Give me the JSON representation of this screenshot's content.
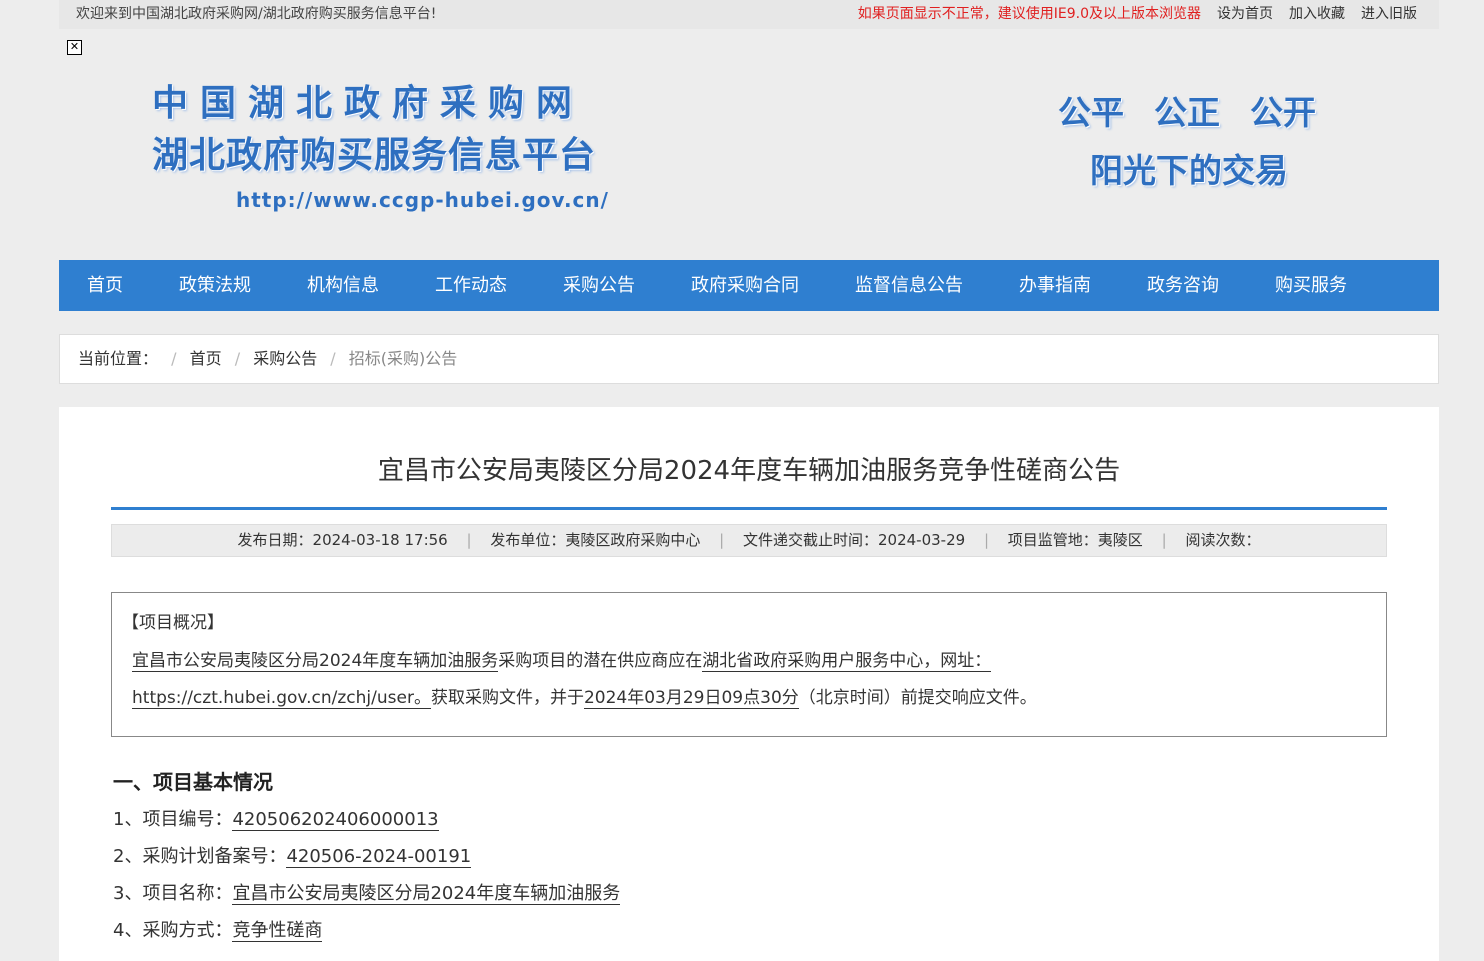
{
  "topbar": {
    "welcome": "欢迎来到中国湖北政府采购网/湖北政府购买服务信息平台!",
    "warning": "如果页面显示不正常，建议使用IE9.0及以上版本浏览器",
    "set_home": "设为首页",
    "add_favorite": "加入收藏",
    "old_version": "进入旧版"
  },
  "header": {
    "close_glyph": "✕",
    "logo_line1": "中国湖北政府采购网",
    "logo_line2": "湖北政府购买服务信息平台",
    "logo_url": "http://www.ccgp-hubei.gov.cn/",
    "slogan_fair": "公平",
    "slogan_just": "公正",
    "slogan_open": "公开",
    "slogan_line2": "阳光下的交易"
  },
  "nav": {
    "items": [
      "首页",
      "政策法规",
      "机构信息",
      "工作动态",
      "采购公告",
      "政府采购合同",
      "监督信息公告",
      "办事指南",
      "政务咨询",
      "购买服务"
    ]
  },
  "breadcrumb": {
    "label": "当前位置：",
    "sep": "/",
    "home": "首页",
    "section": "采购公告",
    "current": "招标(采购)公告"
  },
  "article": {
    "title": "宜昌市公安局夷陵区分局2024年度车辆加油服务竞争性磋商公告",
    "meta": {
      "publish_date": "发布日期：2024-03-18 17:56",
      "publisher": "发布单位：夷陵区政府采购中心",
      "deadline": "文件递交截止时间：2024-03-29",
      "supervision": "项目监管地：夷陵区",
      "reads": "阅读次数：",
      "bar": "|"
    },
    "overview": {
      "heading": "【项目概况】",
      "p1_a": "宜昌市公安局夷陵区分局2024年度车辆加油服务",
      "p1_b": "采购项目的潜在供应商应在",
      "p1_c": "湖北省政府采购用户服务中心，网址：",
      "p2_a": "https://czt.hubei.gov.cn/zchj/user。",
      "p2_b": "获取采购文件，并于",
      "p2_c": "2024年03月29日09点30分",
      "p2_d": "（北京时间）前提交响应文件。"
    },
    "section1_title": "一、项目基本情况",
    "items": [
      {
        "label": "1、项目编号：",
        "value": "420506202406000013"
      },
      {
        "label": "2、采购计划备案号：",
        "value": "420506-2024-00191"
      },
      {
        "label": "3、项目名称：",
        "value": "宜昌市公安局夷陵区分局2024年度车辆加油服务"
      },
      {
        "label": "4、采购方式：",
        "value": "竞争性磋商"
      }
    ]
  }
}
